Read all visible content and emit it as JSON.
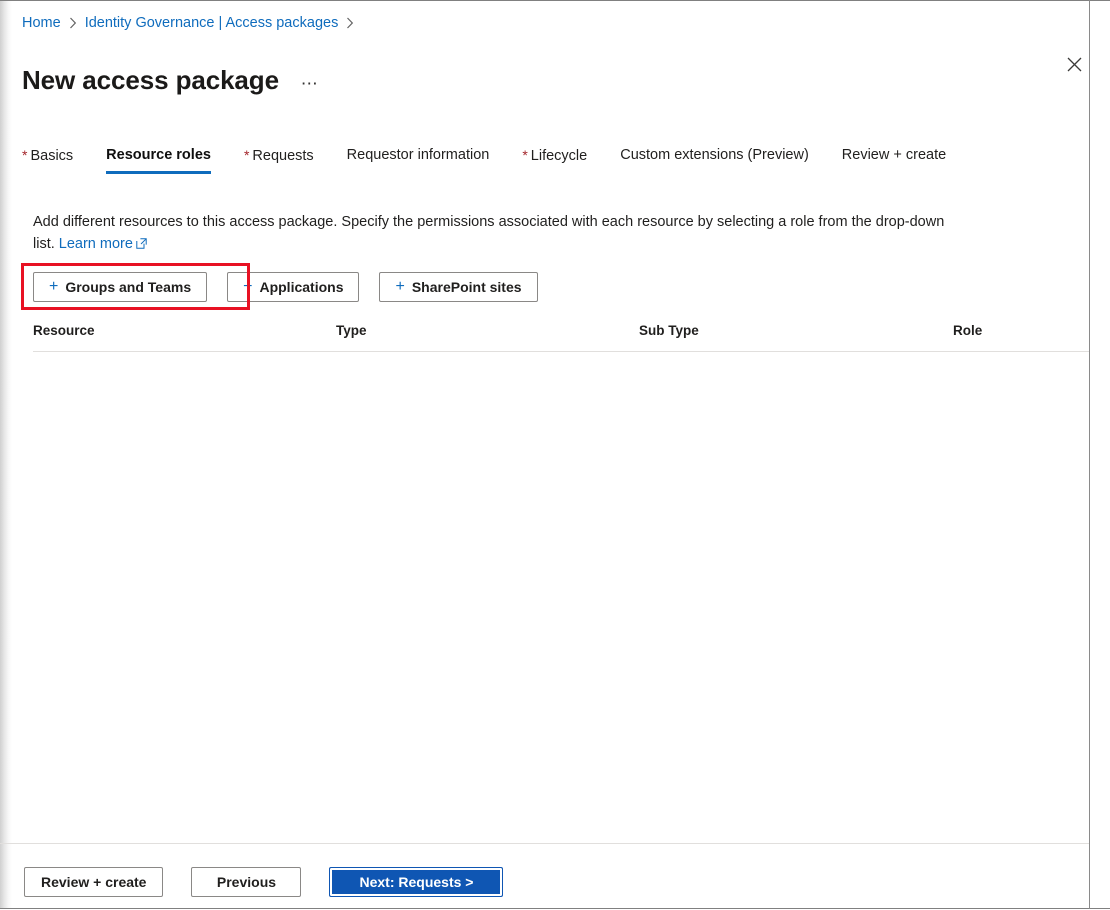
{
  "breadcrumb": {
    "items": [
      {
        "label": "Home"
      },
      {
        "label": "Identity Governance | Access packages"
      }
    ],
    "separator": "chevron-right-icon"
  },
  "header": {
    "title": "New access package",
    "more_label": "⋯",
    "close_label": "✕"
  },
  "tabs": [
    {
      "label": "Basics",
      "required": true,
      "active": false
    },
    {
      "label": "Resource roles",
      "required": false,
      "active": true
    },
    {
      "label": "Requests",
      "required": true,
      "active": false
    },
    {
      "label": "Requestor information",
      "required": false,
      "active": false
    },
    {
      "label": "Lifecycle",
      "required": true,
      "active": false
    },
    {
      "label": "Custom extensions (Preview)",
      "required": false,
      "active": false
    },
    {
      "label": "Review + create",
      "required": false,
      "active": false
    }
  ],
  "description": {
    "text": "Add different resources to this access package. Specify the permissions associated with each resource by selecting a role from the drop-down list.",
    "link_label": "Learn more",
    "link_icon": "external-link-icon"
  },
  "add_buttons": [
    {
      "label": "Groups and Teams",
      "icon": "plus-icon",
      "highlighted": true
    },
    {
      "label": "Applications",
      "icon": "plus-icon",
      "highlighted": false
    },
    {
      "label": "SharePoint sites",
      "icon": "plus-icon",
      "highlighted": false
    }
  ],
  "table": {
    "columns": [
      "Resource",
      "Type",
      "Sub Type",
      "Role"
    ],
    "rows": []
  },
  "footer": {
    "review_create_label": "Review + create",
    "previous_label": "Previous",
    "next_label": "Next: Requests >"
  },
  "colors": {
    "accent": "#0f6cbd",
    "primary_button": "#0f56b3",
    "required_star": "#a4262c",
    "highlight_box": "#e81123",
    "text": "#201f1e"
  }
}
